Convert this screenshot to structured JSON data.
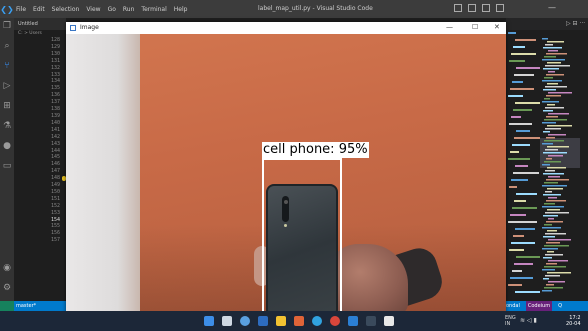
{
  "vscode": {
    "menu": [
      "File",
      "Edit",
      "Selection",
      "View",
      "Go",
      "Run",
      "Terminal",
      "Help"
    ],
    "window_title": "label_map_util.py - Visual Studio Code",
    "tab_label": "Untitled",
    "breadcrumb": "C: > Users",
    "line_numbers": [
      "128",
      "129",
      "130",
      "131",
      "132",
      "133",
      "134",
      "135",
      "136",
      "137",
      "138",
      "139",
      "140",
      "141",
      "142",
      "143",
      "144",
      "145",
      "146",
      "147",
      "148",
      "149",
      "150",
      "151",
      "152",
      "153",
      "154",
      "155",
      "156",
      "157"
    ],
    "current_line": "154",
    "status": {
      "branch": "master*",
      "right": [
        "ondal",
        "Codeium",
        "Q"
      ]
    }
  },
  "image_window": {
    "title": "Image",
    "controls": {
      "minimize": "—",
      "maximize": "☐",
      "close": "✕"
    },
    "detection": {
      "label": "cell phone: 95%",
      "class": "cell phone",
      "score": 0.95
    }
  },
  "taskbar": {
    "apps": [
      "windows-start",
      "search",
      "task-view",
      "widgets",
      "file-explorer",
      "browser-edge",
      "chrome",
      "security",
      "vscode",
      "terminal",
      "notepad"
    ],
    "tray": {
      "lang": "ENG",
      "region": "IN"
    },
    "clock": {
      "time": "17:2",
      "date": "20-04"
    }
  },
  "colors": {
    "vscode_status": "#007acc",
    "taskbar": "#1c2738",
    "wall": "#c86a47",
    "box": "#ffffff"
  }
}
